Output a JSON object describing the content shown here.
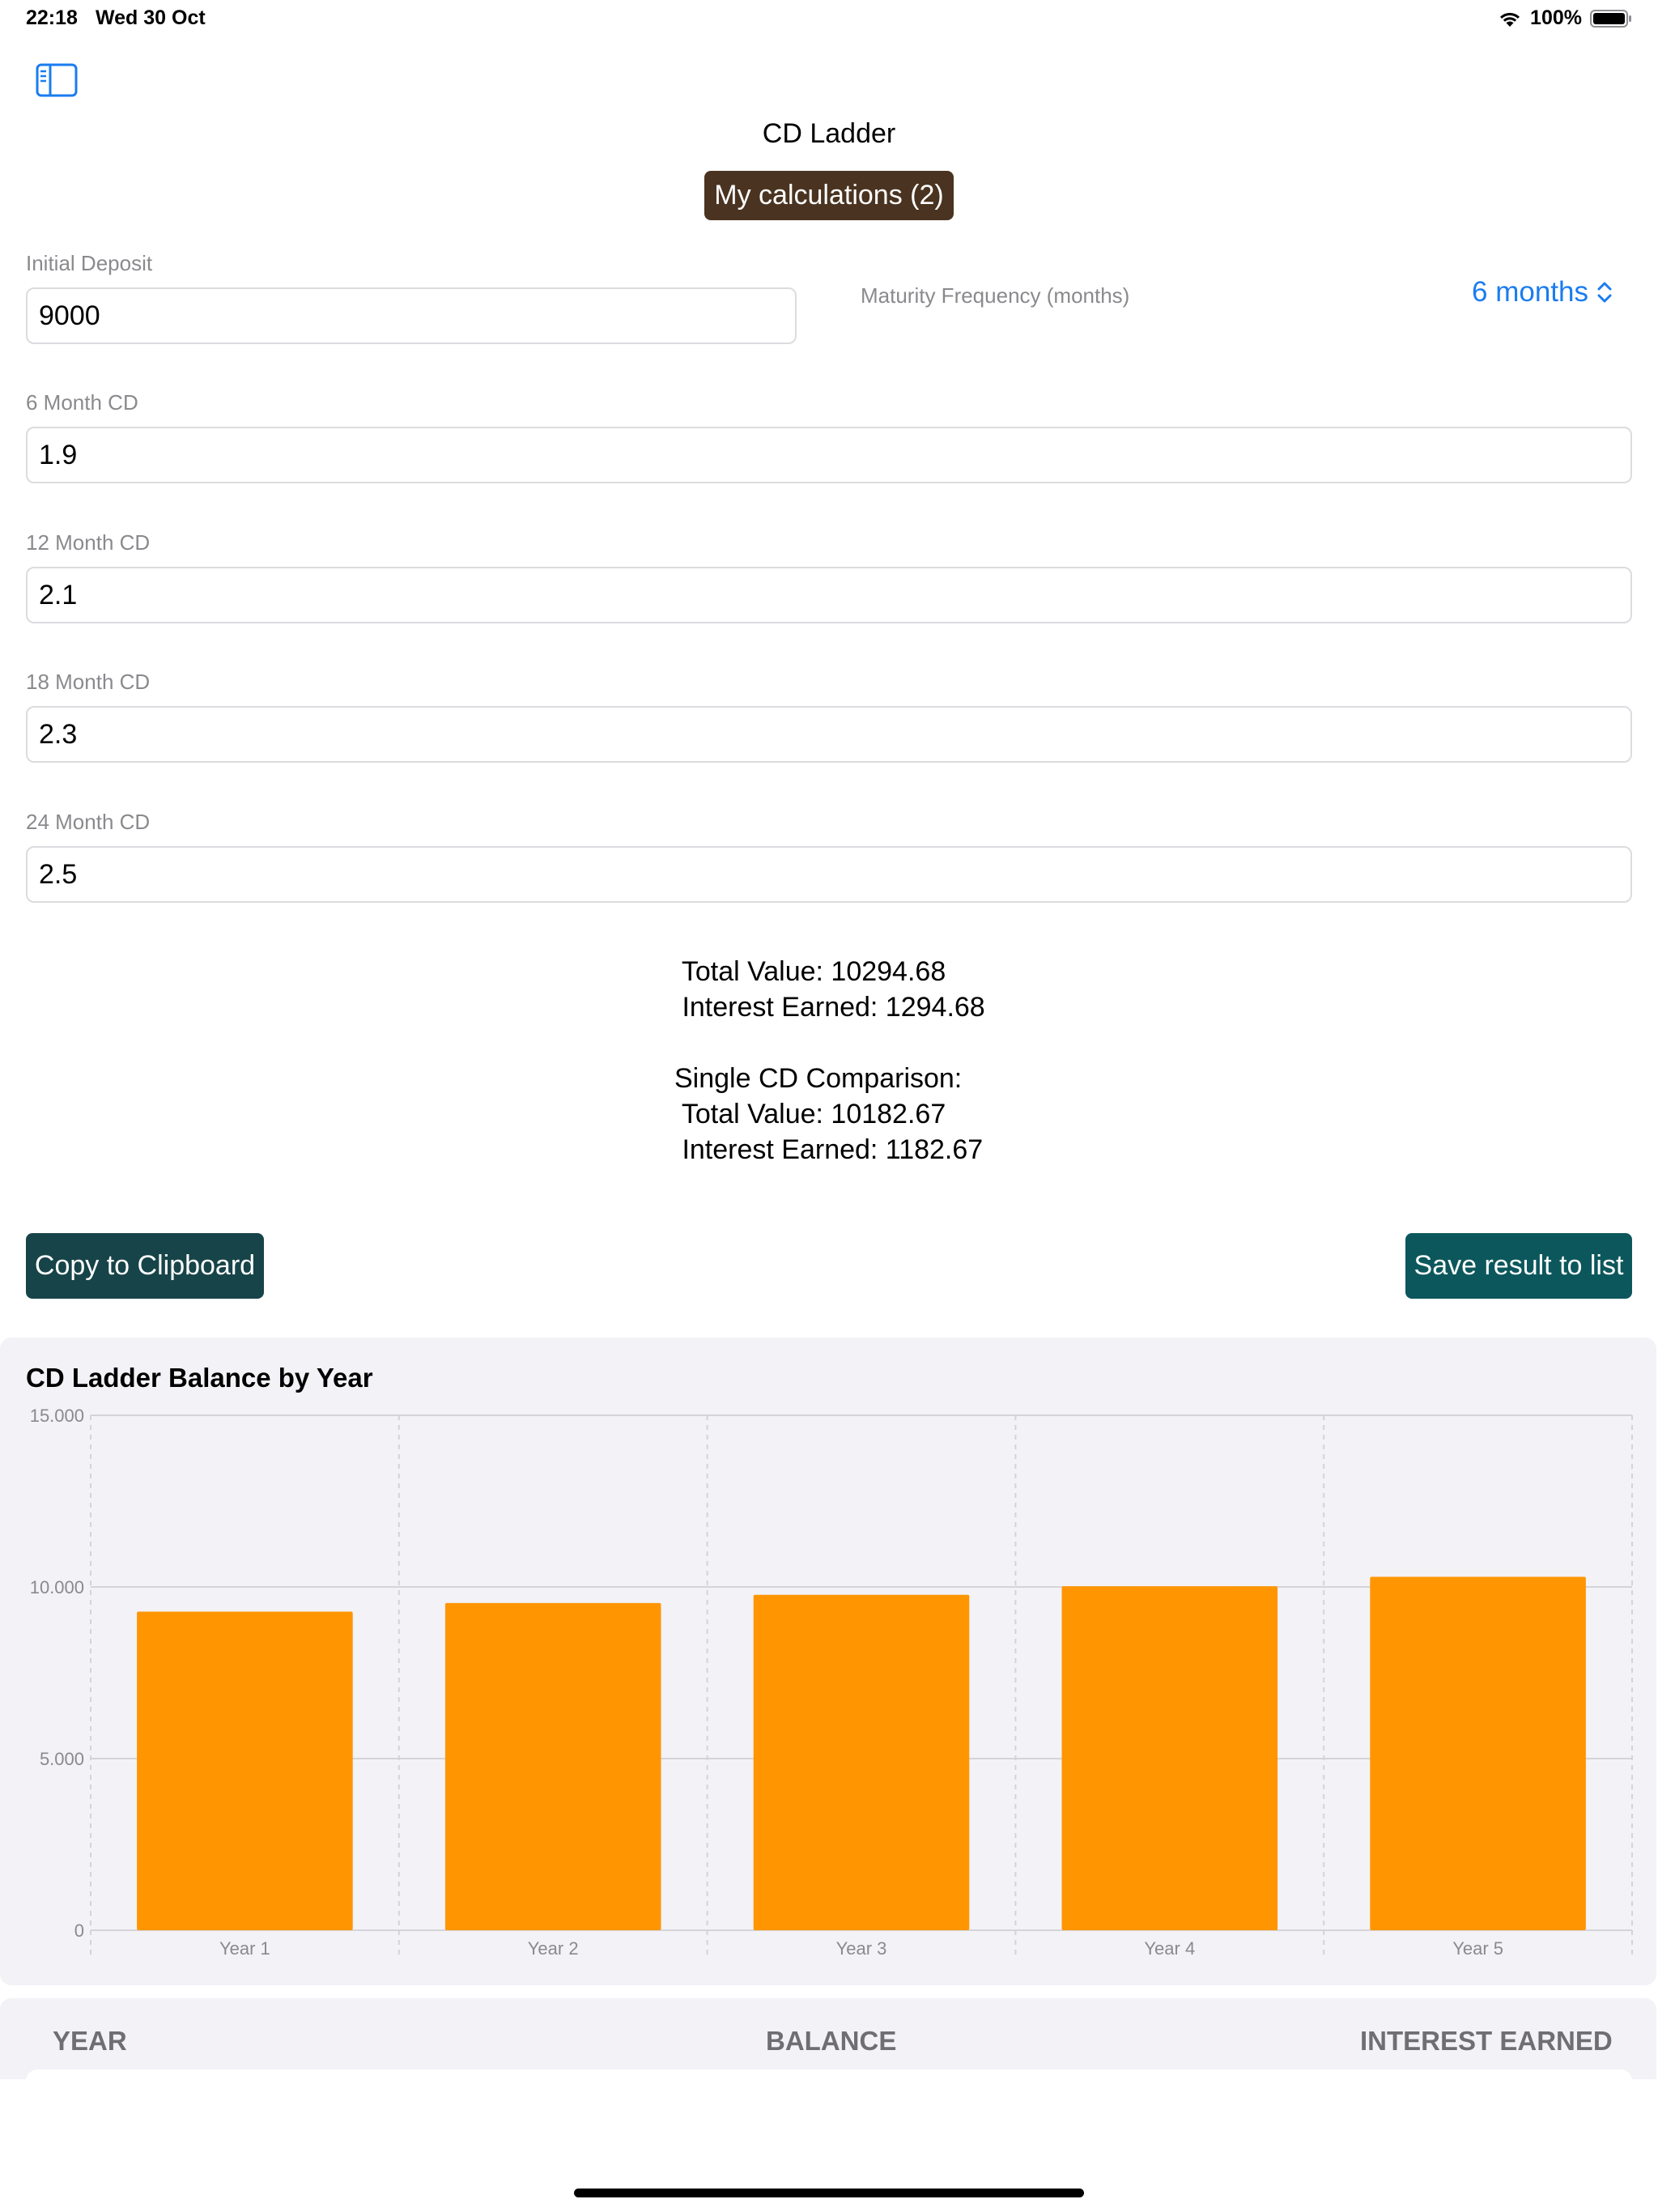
{
  "status_bar": {
    "time": "22:18",
    "date": "Wed 30 Oct",
    "battery": "100%"
  },
  "nav": {
    "title": "CD Ladder",
    "calculations_button": "My calculations (2)"
  },
  "form": {
    "initial_deposit_label": "Initial Deposit",
    "initial_deposit_value": "9000",
    "maturity_label": "Maturity Frequency (months)",
    "maturity_value": "6 months",
    "cd6_label": "6 Month CD",
    "cd6_value": "1.9",
    "cd12_label": "12 Month CD",
    "cd12_value": "2.1",
    "cd18_label": "18 Month CD",
    "cd18_value": "2.3",
    "cd24_label": "24 Month CD",
    "cd24_value": "2.5"
  },
  "results": {
    "total_value": " Total Value: 10294.68",
    "interest_earned": " Interest Earned: 1294.68",
    "comparison_title": "Single CD Comparison:",
    "comparison_total": " Total Value: 10182.67",
    "comparison_interest": " Interest Earned: 1182.67"
  },
  "actions": {
    "copy_label": "Copy to Clipboard",
    "save_label": "Save result to list"
  },
  "chart_data": {
    "type": "bar",
    "title": "CD Ladder Balance by Year",
    "categories": [
      "Year 1",
      "Year 2",
      "Year 3",
      "Year 4",
      "Year 5"
    ],
    "values": [
      9280,
      9530,
      9770,
      10020,
      10294.68
    ],
    "ylim": [
      0,
      15000
    ],
    "yticks": [
      0,
      5000,
      10000,
      15000
    ],
    "ytick_labels": [
      "0",
      "5.000",
      "10.000",
      "15.000"
    ],
    "color": "#ff9500",
    "grid": true
  },
  "table": {
    "col_year": "YEAR",
    "col_balance": "BALANCE",
    "col_interest": "INTEREST EARNED"
  },
  "colors": {
    "accent": "#1a7cf0",
    "calc_button": "#4a3320",
    "copy_button": "#174448",
    "save_button": "#0c575c",
    "bar": "#ff9500"
  }
}
